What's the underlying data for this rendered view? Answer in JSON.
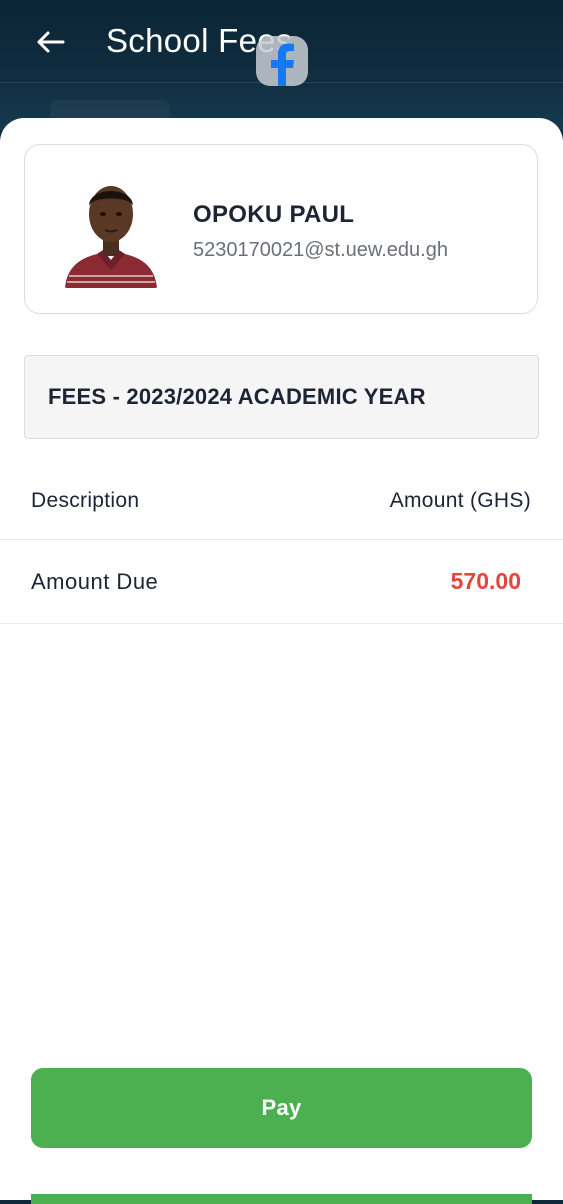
{
  "header": {
    "title": "School Fees",
    "back_icon": "back-arrow-icon",
    "overlay_icon": "facebook-icon"
  },
  "profile": {
    "name": "OPOKU PAUL",
    "email": "5230170021@st.uew.edu.gh"
  },
  "fees": {
    "banner": "FEES - 2023/2024 ACADEMIC YEAR",
    "columns": {
      "description": "Description",
      "amount": "Amount (GHS)"
    },
    "rows": [
      {
        "description": "Amount Due",
        "amount": "570.00"
      }
    ]
  },
  "actions": {
    "pay_label": "Pay"
  },
  "colors": {
    "header_bg": "#0e2a3a",
    "accent_green": "#4caf50",
    "amount_red": "#e1473d",
    "facebook_blue": "#1877f2"
  }
}
